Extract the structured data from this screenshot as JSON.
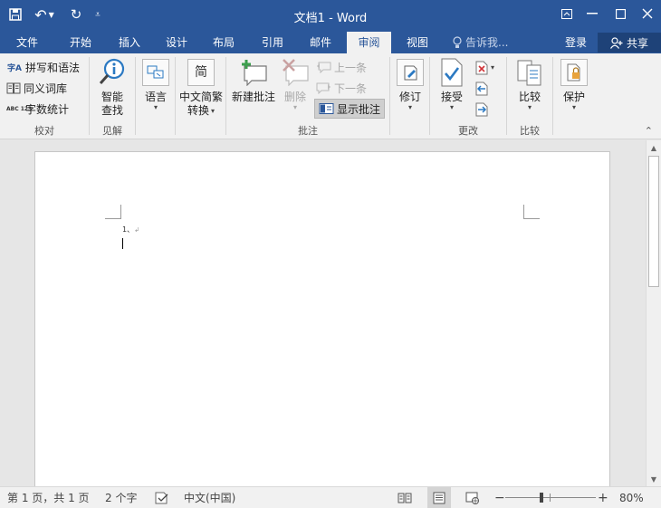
{
  "window": {
    "title": "文档1 - Word"
  },
  "tabs": [
    {
      "label": "文件"
    },
    {
      "label": "开始"
    },
    {
      "label": "插入"
    },
    {
      "label": "设计"
    },
    {
      "label": "布局"
    },
    {
      "label": "引用"
    },
    {
      "label": "邮件"
    },
    {
      "label": "审阅",
      "active": true
    },
    {
      "label": "视图"
    }
  ],
  "tell_me": {
    "placeholder": "告诉我..."
  },
  "account": {
    "login": "登录",
    "share": "共享"
  },
  "ribbon": {
    "proofing": {
      "label": "校对",
      "spelling": "拼写和语法",
      "thesaurus": "同义词库",
      "word_count": "字数统计",
      "spelling_glyph": "字A",
      "word_count_glyph": "ABC 123"
    },
    "insights": {
      "label": "见解",
      "smart_lookup_line1": "智能",
      "smart_lookup_line2": "查找"
    },
    "language": {
      "label": "语言"
    },
    "chinese_conversion": {
      "line1": "中文简繁",
      "line2": "转换",
      "glyph": "简"
    },
    "comments": {
      "label": "批注",
      "new_comment": "新建批注",
      "delete": "删除",
      "previous": "上一条",
      "next": "下一条",
      "show_comments": "显示批注"
    },
    "tracking": {
      "track_changes": "修订"
    },
    "changes": {
      "label": "更改",
      "accept": "接受"
    },
    "compare": {
      "label": "比较",
      "compare": "比较"
    },
    "protect": {
      "protect": "保护"
    }
  },
  "document": {
    "list_marker": "1、"
  },
  "status": {
    "page": "第 1 页，共 1 页",
    "words": "2 个字",
    "language": "中文(中国)",
    "zoom": "80%",
    "zoom_fraction": 0.4
  },
  "colors": {
    "brand": "#2b579a",
    "ribbon_bg": "#f1f1f1",
    "doc_bg": "#e6e6e6"
  }
}
